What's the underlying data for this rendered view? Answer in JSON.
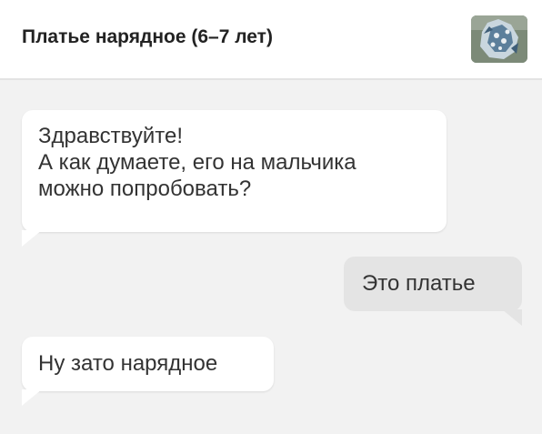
{
  "header": {
    "title": "Платье нарядное (6–7 лет)",
    "thumbnail": "dress-thumbnail-image"
  },
  "messages": [
    {
      "direction": "incoming",
      "text": "Здравствуйте!\nА как думаете, его на мальчика\nможно попробовать?"
    },
    {
      "direction": "outgoing",
      "text": "Это платье"
    },
    {
      "direction": "incoming",
      "text": "Ну зато нарядное"
    }
  ],
  "colors": {
    "background": "#f2f2f2",
    "header": "#ffffff",
    "incoming_bubble": "#ffffff",
    "outgoing_bubble": "#e4e4e4",
    "text": "#222222"
  }
}
